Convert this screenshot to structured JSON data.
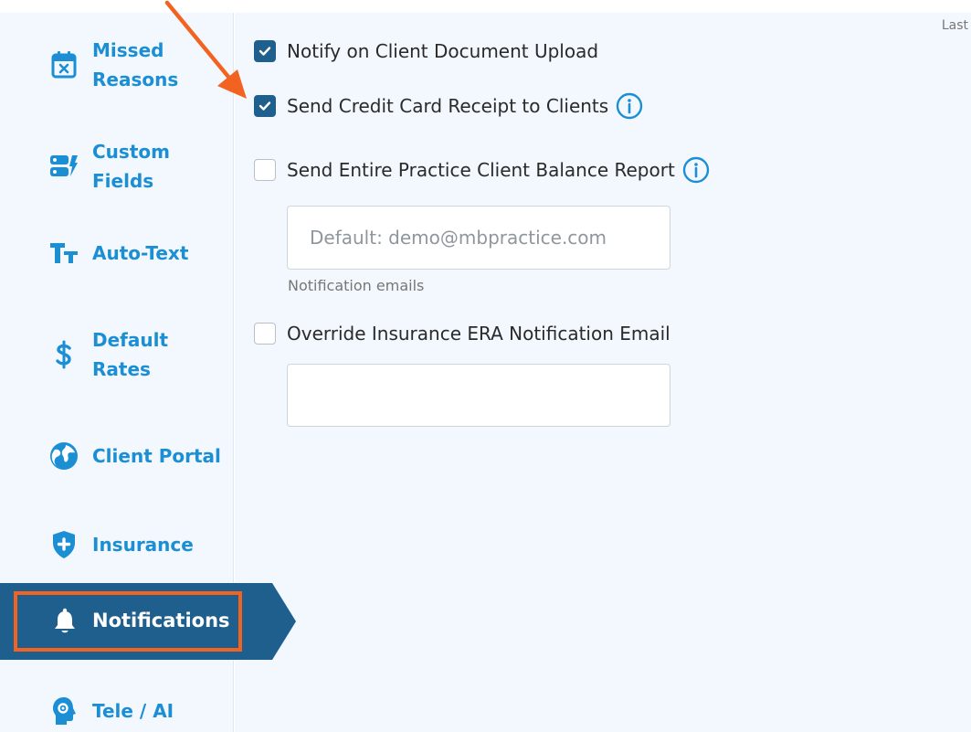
{
  "header": {
    "last_label": "Last"
  },
  "sidebar": {
    "items": [
      {
        "label_line1": "Missed",
        "label_line2": "Reasons",
        "icon": "calendar-x-icon"
      },
      {
        "label_line1": "Custom",
        "label_line2": "Fields",
        "icon": "custom-fields-icon"
      },
      {
        "label": "Auto-Text",
        "icon": "text-size-icon"
      },
      {
        "label_line1": "Default",
        "label_line2": "Rates",
        "icon": "dollar-icon"
      },
      {
        "label": "Client Portal",
        "icon": "globe-icon"
      },
      {
        "label": "Insurance",
        "icon": "shield-plus-icon"
      },
      {
        "label": "Notifications",
        "icon": "bell-icon",
        "active": true
      },
      {
        "label": "Tele / AI",
        "icon": "head-ai-icon"
      }
    ]
  },
  "settings": {
    "notify_upload": {
      "label": "Notify on Client Document Upload",
      "checked": true
    },
    "send_receipt": {
      "label": "Send Credit Card Receipt to Clients",
      "checked": true
    },
    "balance_report": {
      "label": "Send Entire Practice Client Balance Report",
      "checked": false
    },
    "notification_email": {
      "placeholder": "Default: demo@mbpractice.com",
      "value": "",
      "help": "Notification emails"
    },
    "era_override": {
      "label": "Override Insurance ERA Notification Email",
      "checked": false
    },
    "era_email": {
      "placeholder": "",
      "value": ""
    }
  },
  "colors": {
    "accent": "#1b8ed4",
    "active_nav": "#1f5f8d",
    "annotation": "#f26322",
    "background": "#f2f8fd"
  }
}
